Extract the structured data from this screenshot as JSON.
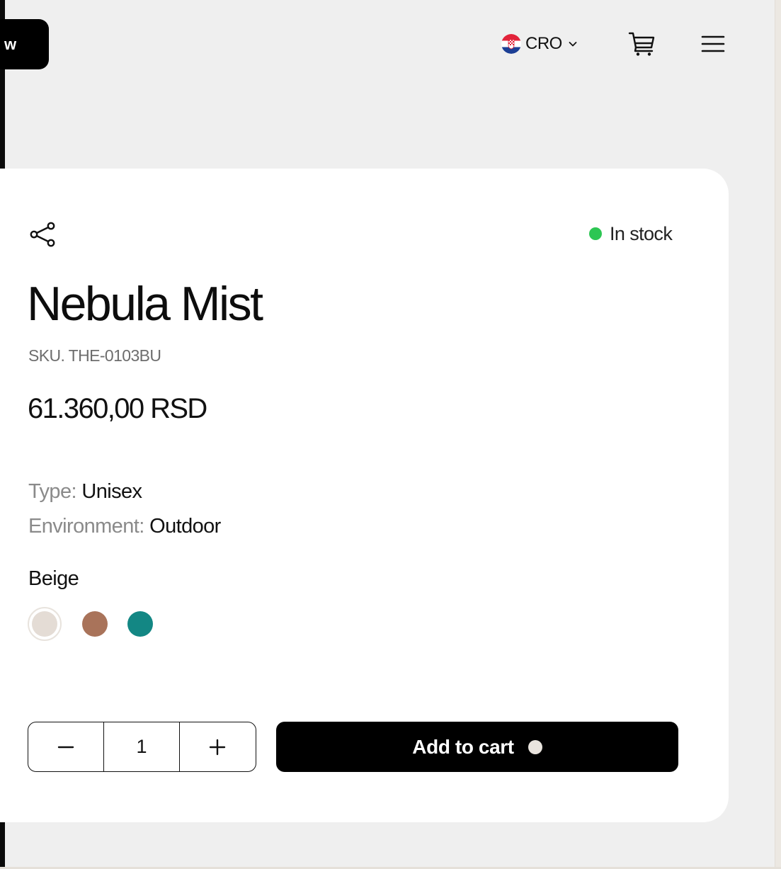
{
  "header": {
    "pill_label": "w",
    "language": {
      "code": "CRO",
      "flag_icon": "croatia-flag-icon"
    },
    "cart_icon": "cart-icon",
    "menu_icon": "hamburger-menu-icon"
  },
  "product": {
    "share_icon": "share-icon",
    "stock_status": "In stock",
    "stock_color": "#2dc653",
    "title": "Nebula Mist",
    "sku": "SKU. THE-0103BU",
    "price": "61.360,00 RSD",
    "attributes": [
      {
        "key": "Type:",
        "value": "Unisex"
      },
      {
        "key": "Environment:",
        "value": "Outdoor"
      }
    ],
    "selected_color": "Beige",
    "swatches": [
      {
        "name": "beige",
        "hex": "#e4dcd5",
        "selected": true
      },
      {
        "name": "brown",
        "hex": "#a9735a",
        "selected": false
      },
      {
        "name": "teal",
        "hex": "#138784",
        "selected": false
      }
    ],
    "quantity": "1",
    "add_to_cart_label": "Add to cart"
  },
  "colors": {
    "background": "#efefef",
    "card": "#ffffff",
    "primary_button": "#000000"
  }
}
